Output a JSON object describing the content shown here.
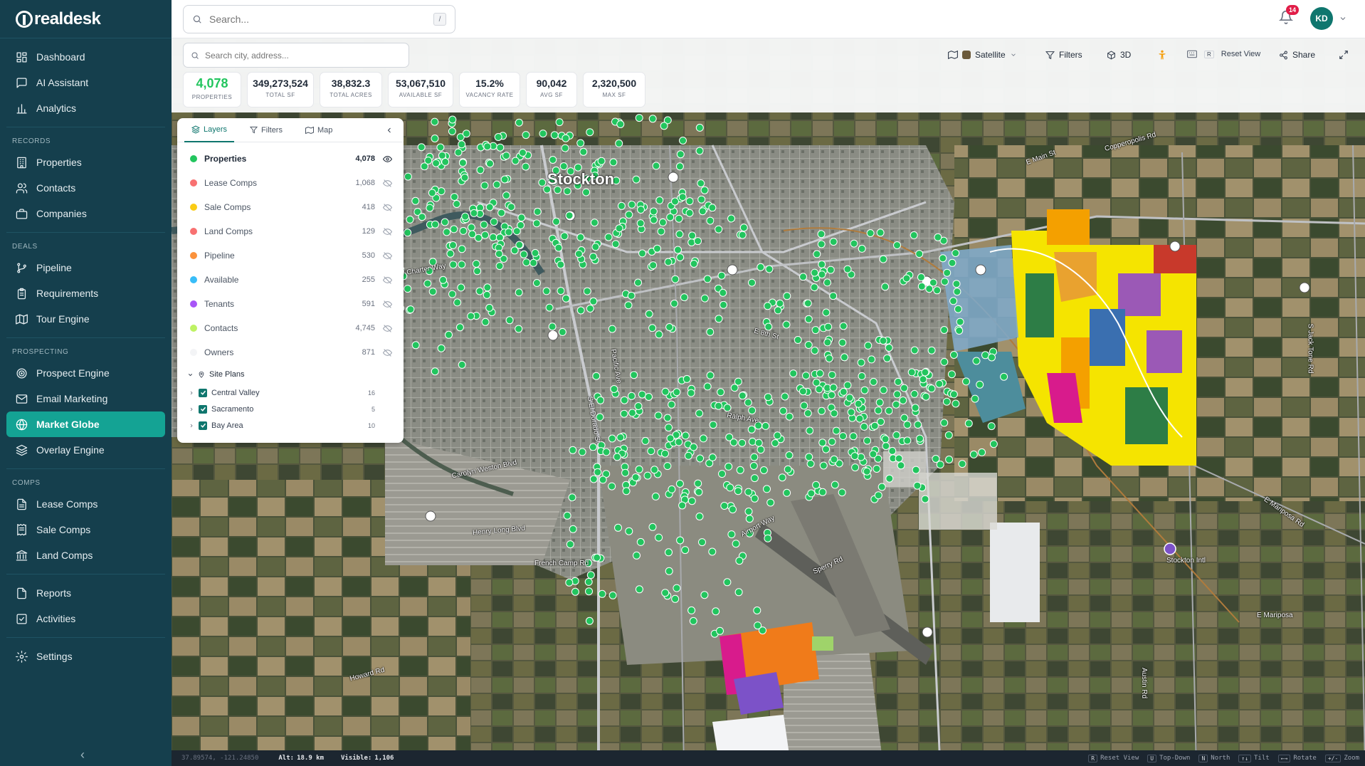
{
  "app": {
    "logo": "realdesk"
  },
  "sidebar": {
    "main": [
      {
        "label": "Dashboard",
        "icon": "dashboard-icon"
      },
      {
        "label": "AI Assistant",
        "icon": "chat-icon"
      },
      {
        "label": "Analytics",
        "icon": "bar-chart-icon"
      }
    ],
    "sections": [
      {
        "title": "RECORDS",
        "items": [
          {
            "label": "Properties",
            "icon": "building-icon"
          },
          {
            "label": "Contacts",
            "icon": "users-icon"
          },
          {
            "label": "Companies",
            "icon": "briefcase-icon"
          }
        ]
      },
      {
        "title": "DEALS",
        "items": [
          {
            "label": "Pipeline",
            "icon": "git-branch-icon"
          },
          {
            "label": "Requirements",
            "icon": "clipboard-icon"
          },
          {
            "label": "Tour Engine",
            "icon": "map-icon"
          }
        ]
      },
      {
        "title": "PROSPECTING",
        "items": [
          {
            "label": "Prospect Engine",
            "icon": "target-icon"
          },
          {
            "label": "Email Marketing",
            "icon": "mail-icon"
          },
          {
            "label": "Market Globe",
            "icon": "globe-icon",
            "active": true
          },
          {
            "label": "Overlay Engine",
            "icon": "layers-icon"
          }
        ]
      },
      {
        "title": "COMPS",
        "items": [
          {
            "label": "Lease Comps",
            "icon": "file-icon"
          },
          {
            "label": "Sale Comps",
            "icon": "receipt-icon"
          },
          {
            "label": "Land Comps",
            "icon": "landmark-icon"
          }
        ]
      }
    ],
    "bottom": [
      {
        "label": "Reports",
        "icon": "report-icon"
      },
      {
        "label": "Activities",
        "icon": "checklist-icon"
      }
    ],
    "settings": {
      "label": "Settings",
      "icon": "gear-icon"
    },
    "collapse_glyph": "‹"
  },
  "topbar": {
    "search_placeholder": "Search...",
    "search_shortcut": "/",
    "notification_count": "14",
    "avatar_initials": "KD"
  },
  "map_toolbar": {
    "city_search_placeholder": "Search city, address...",
    "basemap": "Satellite",
    "filters": "Filters",
    "three_d": "3D",
    "reset_key": "R",
    "reset_view": "Reset View",
    "share": "Share"
  },
  "stats": [
    {
      "value": "4,078",
      "label": "PROPERTIES"
    },
    {
      "value": "349,273,524",
      "label": "TOTAL SF"
    },
    {
      "value": "38,832.3",
      "label": "TOTAL ACRES"
    },
    {
      "value": "53,067,510",
      "label": "AVAILABLE SF"
    },
    {
      "value": "15.2%",
      "label": "VACANCY RATE"
    },
    {
      "value": "90,042",
      "label": "AVG SF"
    },
    {
      "value": "2,320,500",
      "label": "MAX SF"
    }
  ],
  "layers_panel": {
    "tabs": [
      "Layers",
      "Filters",
      "Map"
    ],
    "layers": [
      {
        "label": "Properties",
        "count": "4,078",
        "color": "#22c55e",
        "visible": true
      },
      {
        "label": "Lease Comps",
        "count": "1,068",
        "color": "#f87171",
        "visible": false
      },
      {
        "label": "Sale Comps",
        "count": "418",
        "color": "#facc15",
        "visible": false
      },
      {
        "label": "Land Comps",
        "count": "129",
        "color": "#f87171",
        "visible": false
      },
      {
        "label": "Pipeline",
        "count": "530",
        "color": "#fb923c",
        "visible": false
      },
      {
        "label": "Available",
        "count": "255",
        "color": "#38bdf8",
        "visible": false
      },
      {
        "label": "Tenants",
        "count": "591",
        "color": "#a855f7",
        "visible": false
      },
      {
        "label": "Contacts",
        "count": "4,745",
        "color": "#bef264",
        "visible": false
      },
      {
        "label": "Owners",
        "count": "871",
        "color": "#f3f4f6",
        "visible": false
      }
    ],
    "site_plans_title": "Site Plans",
    "site_plans": [
      {
        "label": "Central Valley",
        "count": "16"
      },
      {
        "label": "Sacramento",
        "count": "5"
      },
      {
        "label": "Bay Area",
        "count": "10"
      }
    ]
  },
  "map_labels": {
    "city": "Stockton",
    "streets": [
      "March Ln",
      "E Main St",
      "Copperopolis Rd",
      "E Mariposa Rd",
      "French Camp Rd",
      "Howard Rd",
      "Henry Long Blvd",
      "Ralph Ave",
      "Airport Way",
      "S Jack Tone Rd",
      "Austin Rd",
      "Carolyn Weston Blvd",
      "W Charter Way",
      "Pacific Ave",
      "E 8th St",
      "Arch Airport Rd",
      "Stockton Intl",
      "S El Dorado St",
      "E Mariposa",
      "Sperry Rd"
    ],
    "route_shields": [
      "99",
      "4",
      "5",
      "99",
      "4",
      "4",
      "99"
    ]
  },
  "status_bar": {
    "coords": "37.89574, -121.24850",
    "alt_label": "Alt:",
    "alt_value": "18.9 km",
    "visible_label": "Visible:",
    "visible_value": "1,106",
    "keys": [
      {
        "key": "R",
        "label": "Reset View"
      },
      {
        "key": "U",
        "label": "Top-Down"
      },
      {
        "key": "N",
        "label": "North"
      },
      {
        "key": "↑↓",
        "label": "Tilt"
      },
      {
        "key": "←→",
        "label": "Rotate"
      },
      {
        "key": "+/-",
        "label": "Zoom"
      }
    ]
  }
}
